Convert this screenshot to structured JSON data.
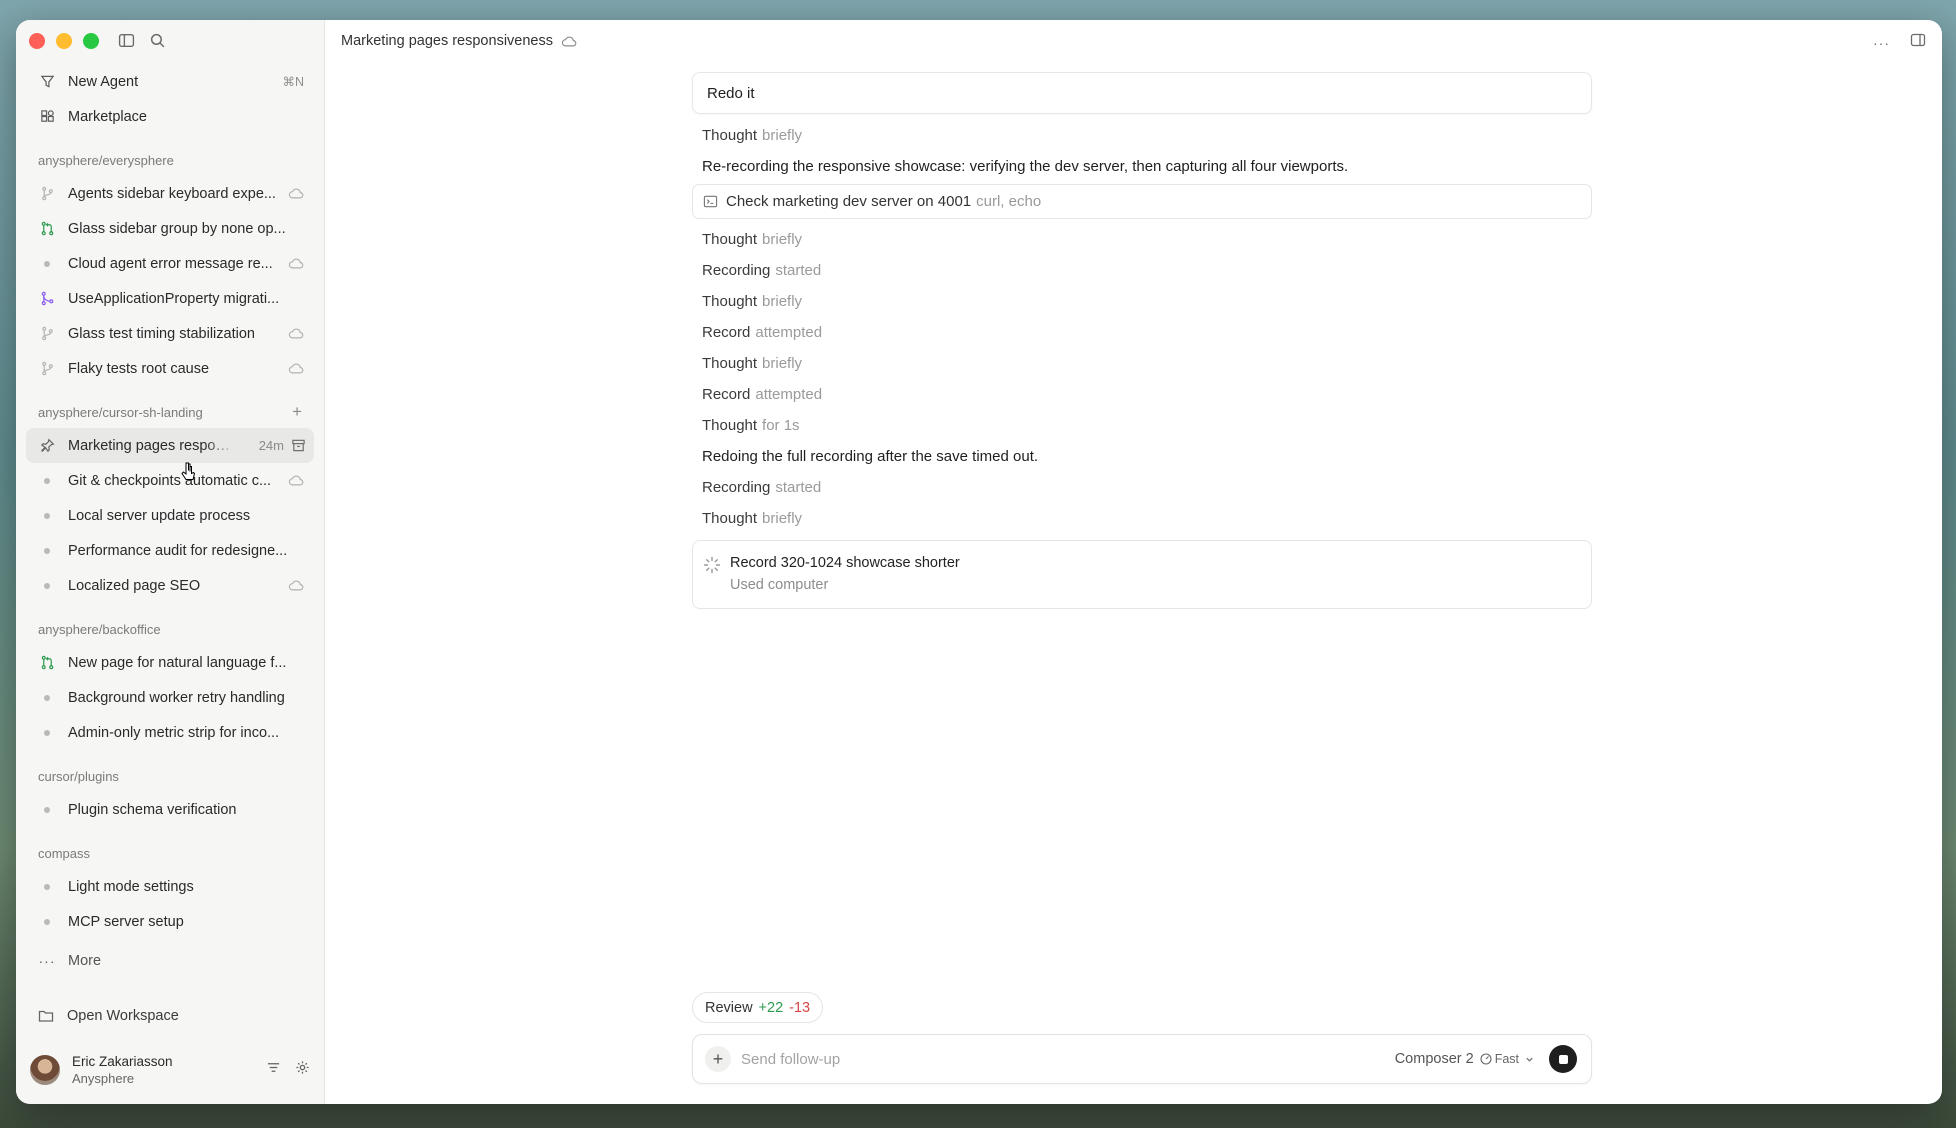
{
  "sidebar": {
    "nav": [
      {
        "label": "New Agent",
        "shortcut": "⌘N",
        "icon": "agent-icon"
      },
      {
        "label": "Marketplace",
        "icon": "marketplace-icon"
      }
    ],
    "groups": [
      {
        "label": "anysphere/everysphere",
        "items": [
          {
            "label": "Agents sidebar keyboard expe...",
            "icon": "branch-icon",
            "cloud": true
          },
          {
            "label": "Glass sidebar group by none op...",
            "icon": "pull-request-icon",
            "cloud": false
          },
          {
            "label": "Cloud agent error message re...",
            "icon": "dot",
            "cloud": true
          },
          {
            "label": "UseApplicationProperty migrati...",
            "icon": "merged-icon",
            "cloud": false
          },
          {
            "label": "Glass test timing stabilization",
            "icon": "branch-icon",
            "cloud": true
          },
          {
            "label": "Flaky tests root cause",
            "icon": "branch-icon",
            "cloud": true
          }
        ]
      },
      {
        "label": "anysphere/cursor-sh-landing",
        "add": "+",
        "items": [
          {
            "label": "Marketing pages responsiveness",
            "icon": "pin-icon",
            "time": "24m",
            "active": true
          },
          {
            "label": "Git & checkpoints automatic c...",
            "icon": "dot",
            "cloud": true
          },
          {
            "label": "Local server update process",
            "icon": "dot"
          },
          {
            "label": "Performance audit for redesigne...",
            "icon": "dot"
          },
          {
            "label": "Localized page SEO",
            "icon": "dot",
            "cloud": true
          }
        ]
      },
      {
        "label": "anysphere/backoffice",
        "items": [
          {
            "label": "New page for natural language f...",
            "icon": "pull-request-icon"
          },
          {
            "label": "Background worker retry handling",
            "icon": "dot"
          },
          {
            "label": "Admin-only metric strip for inco...",
            "icon": "dot"
          }
        ]
      },
      {
        "label": "cursor/plugins",
        "items": [
          {
            "label": "Plugin schema verification",
            "icon": "dot"
          }
        ]
      },
      {
        "label": "compass",
        "items": [
          {
            "label": "Light mode settings",
            "icon": "dot"
          },
          {
            "label": "MCP server setup",
            "icon": "dot"
          }
        ]
      }
    ],
    "more_label": "More",
    "open_workspace": "Open Workspace",
    "user": {
      "name": "Eric Zakariasson",
      "org": "Anysphere"
    }
  },
  "header": {
    "title": "Marketing pages responsiveness"
  },
  "chat": {
    "user_message": "Redo it",
    "steps": [
      {
        "kind": "step",
        "bold": "Thought",
        "muted": "briefly"
      },
      {
        "kind": "prose",
        "text": "Re-recording the responsive showcase: verifying the dev server, then capturing all four viewports."
      },
      {
        "kind": "tool",
        "bold": "Check marketing dev server on 4001",
        "muted": "curl, echo"
      },
      {
        "kind": "step",
        "bold": "Thought",
        "muted": "briefly"
      },
      {
        "kind": "step",
        "bold": "Recording",
        "muted": "started"
      },
      {
        "kind": "step",
        "bold": "Thought",
        "muted": "briefly"
      },
      {
        "kind": "step",
        "bold": "Record",
        "muted": "attempted"
      },
      {
        "kind": "step",
        "bold": "Thought",
        "muted": "briefly"
      },
      {
        "kind": "step",
        "bold": "Record",
        "muted": "attempted"
      },
      {
        "kind": "step",
        "bold": "Thought",
        "muted": "for 1s"
      },
      {
        "kind": "prose",
        "text": "Redoing the full recording after the save timed out."
      },
      {
        "kind": "step",
        "bold": "Recording",
        "muted": "started"
      },
      {
        "kind": "step",
        "bold": "Thought",
        "muted": "briefly"
      }
    ],
    "task": {
      "title": "Record 320-1024 showcase shorter",
      "subtitle": "Used computer"
    }
  },
  "review": {
    "label": "Review",
    "additions": "+22",
    "deletions": "-13"
  },
  "composer": {
    "placeholder": "Send follow-up",
    "model": "Composer 2",
    "speed": "Fast"
  }
}
